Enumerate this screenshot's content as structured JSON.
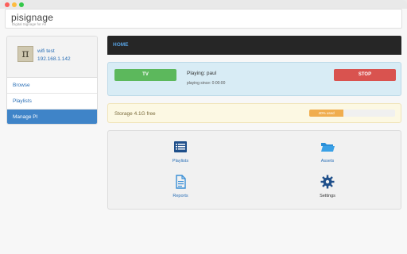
{
  "brand": {
    "name": "pisignage",
    "tagline": "Digital Signage for All"
  },
  "player": {
    "name": "wifi test",
    "ip": "192.168.1.142"
  },
  "sidebar": {
    "items": [
      {
        "label": "Browse"
      },
      {
        "label": "Playlists"
      },
      {
        "label": "Manage PI",
        "active": true
      }
    ]
  },
  "header": {
    "title": "HOME"
  },
  "playback": {
    "tv_label": "TV",
    "playing_text": "Playing: paul",
    "since_text": "playing since: 0:00:00",
    "stop_label": "STOP"
  },
  "storage": {
    "text": "Storage 4.1G free",
    "used_label": "40% used",
    "used_percent": 40
  },
  "tiles": [
    {
      "label": "Playlists",
      "icon": "playlists-icon"
    },
    {
      "label": "Assets",
      "icon": "folder-icon"
    },
    {
      "label": "Reports",
      "icon": "report-icon"
    },
    {
      "label": "Settings",
      "icon": "gear-icon"
    }
  ],
  "colors": {
    "accent": "#3f84c8",
    "tv_green": "#5cb85c",
    "stop_red": "#d9534f",
    "storage_bar": "#f0ad4e",
    "header_dark": "#262626"
  }
}
